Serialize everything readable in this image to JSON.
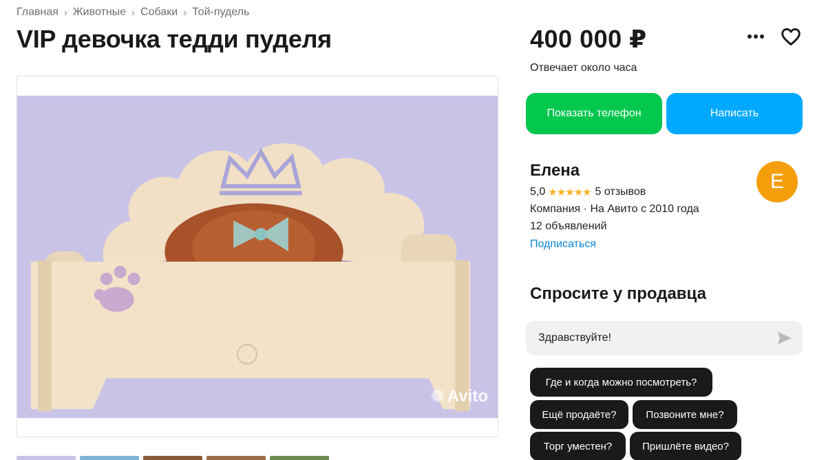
{
  "breadcrumbs": [
    "Главная",
    "Животные",
    "Собаки",
    "Той-пудель"
  ],
  "title": "VIP девочка тедди пуделя",
  "price": "400 000 ₽",
  "response_time": "Отвечает около часа",
  "actions": {
    "more_icon": "more-horizontal-icon",
    "favorite_icon": "heart-icon"
  },
  "buttons": {
    "show_phone": "Показать телефон",
    "write": "Написать"
  },
  "seller": {
    "name": "Елена",
    "rating": "5,0",
    "rating_value": 5,
    "reviews": "5 отзывов",
    "type_since": "Компания · На Авито с 2010 года",
    "listings": "12 объявлений",
    "subscribe": "Подписаться",
    "avatar_letter": "Е",
    "avatar_color": "#f59e0b"
  },
  "ask": {
    "title": "Спросите у продавца",
    "message_value": "Здравствуйте!",
    "quick_questions": [
      "Где и когда можно посмотреть?",
      "Ещё продаёте?",
      "Позвоните мне?",
      "Торг уместен?",
      "Пришлёте видео?"
    ]
  },
  "photo": {
    "watermark": "Avito"
  },
  "colors": {
    "green_button": "#04c74e",
    "blue_button": "#00a9ff",
    "link": "#0a86d8",
    "star": "#ffb021",
    "chip": "#1a1a1a"
  }
}
